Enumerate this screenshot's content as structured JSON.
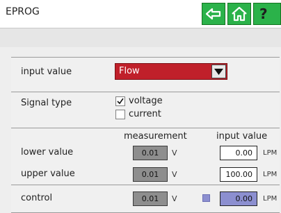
{
  "header": {
    "title": "EPROG",
    "back_icon": "arrow-left-icon",
    "home_icon": "home-icon",
    "help_icon": "question-icon",
    "help_glyph": "?",
    "button_color": "#2bb24a"
  },
  "input_value": {
    "label": "input value",
    "selected": "Flow",
    "select_color": "#c0202a",
    "dropdown_icon": "triangle-down-icon"
  },
  "signal_type": {
    "label": "Signal type",
    "options": [
      {
        "label": "voltage",
        "checked": true
      },
      {
        "label": "current",
        "checked": false
      }
    ]
  },
  "table": {
    "col_measurement": "measurement",
    "col_input": "input value",
    "rows": [
      {
        "label": "lower value",
        "measurement": "0.01",
        "unit": "V",
        "input": "0.00",
        "input_unit": "LPM"
      },
      {
        "label": "upper value",
        "measurement": "0.01",
        "unit": "V",
        "input": "100.00",
        "input_unit": "LPM"
      },
      {
        "label": "control",
        "measurement": "0.01",
        "unit": "V",
        "input": "0.00",
        "input_unit": "LPM"
      }
    ],
    "control_color": "#8c8fd0"
  }
}
